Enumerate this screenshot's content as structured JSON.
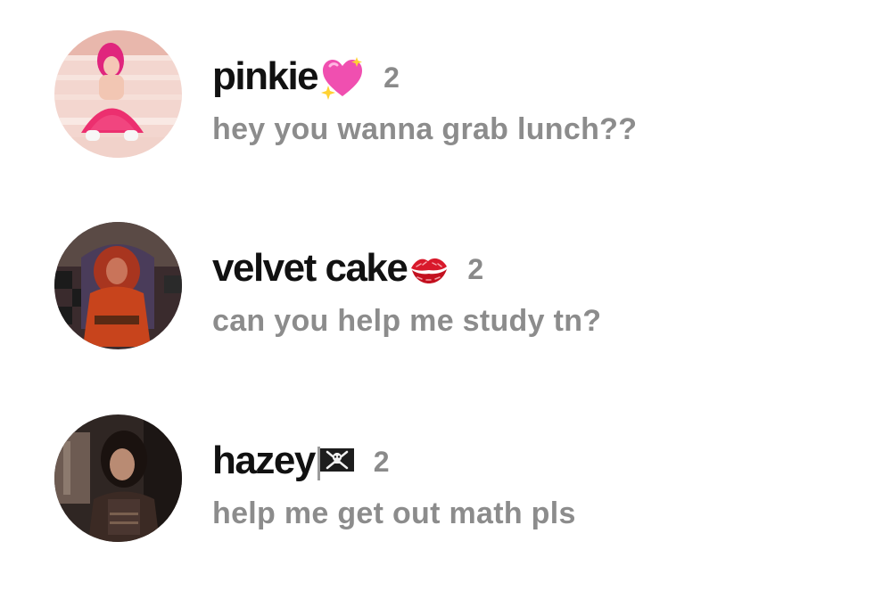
{
  "chats": [
    {
      "name": "pinkie",
      "emoji": "sparkling-heart-icon",
      "count": "2",
      "message": "hey you wanna grab lunch??"
    },
    {
      "name": "velvet cake",
      "emoji": "kiss-mark-icon",
      "count": "2",
      "message": "can you help me study tn?"
    },
    {
      "name": "hazey",
      "emoji": "pirate-flag-icon",
      "count": "2",
      "message": "help me get out math pls"
    }
  ],
  "colors": {
    "name_text": "#111111",
    "message_text": "#8c8c8c",
    "count_text": "#8a8a8a",
    "background": "#ffffff"
  }
}
